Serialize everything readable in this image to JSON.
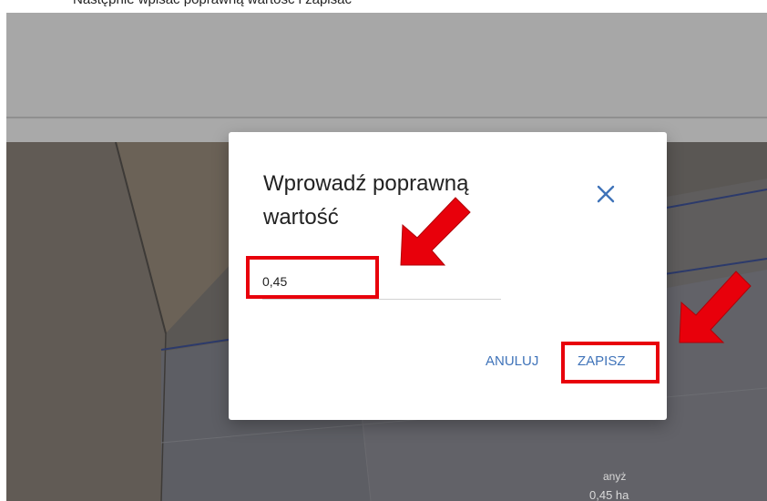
{
  "caption": {
    "text": "Następnie wpisać poprawną wartość i zapisać"
  },
  "dialog": {
    "title": "Wprowadź poprawną wartość",
    "input_value": "0,45",
    "cancel_label": "ANULUJ",
    "save_label": "ZAPISZ",
    "close_icon": "close-icon"
  },
  "map": {
    "label_top": "anyż",
    "label_bottom": "0,45 ha"
  },
  "colors": {
    "accent": "#3f73b9",
    "highlight": "#e8000b",
    "overlay": "#a8a8a8"
  }
}
